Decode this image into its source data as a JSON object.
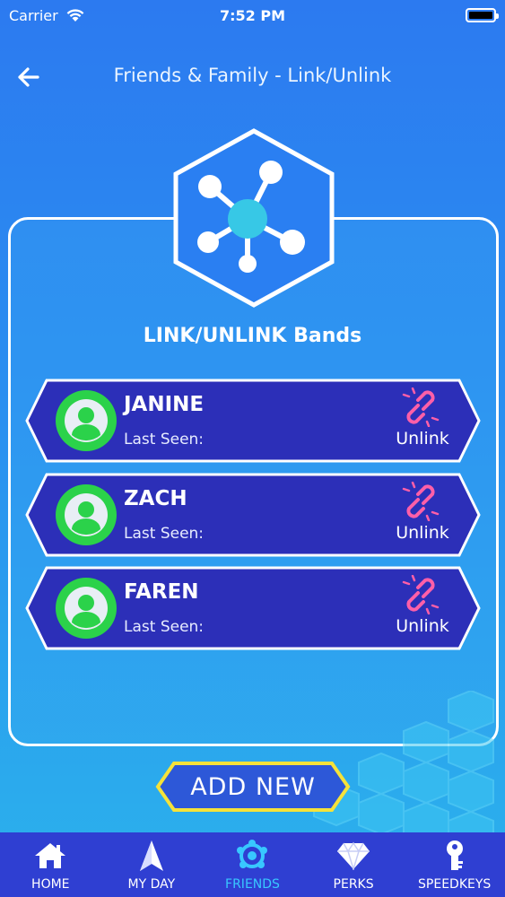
{
  "status_bar": {
    "carrier": "Carrier",
    "time": "7:52 PM"
  },
  "header": {
    "title": "Friends & Family - Link/Unlink"
  },
  "section": {
    "title": "LINK/UNLINK Bands"
  },
  "friends": [
    {
      "name": "JANINE",
      "last_seen_label": "Last Seen:",
      "action_label": "Unlink"
    },
    {
      "name": "ZACH",
      "last_seen_label": "Last Seen:",
      "action_label": "Unlink"
    },
    {
      "name": "FAREN",
      "last_seen_label": "Last Seen:",
      "action_label": "Unlink"
    }
  ],
  "add_new": {
    "label": "ADD NEW"
  },
  "tabs": [
    {
      "label": "HOME",
      "icon": "home-icon"
    },
    {
      "label": "MY DAY",
      "icon": "compass-arrow-icon"
    },
    {
      "label": "FRIENDS",
      "icon": "friends-network-icon",
      "active": true
    },
    {
      "label": "PERKS",
      "icon": "diamond-icon"
    },
    {
      "label": "SPEEDKEYS",
      "icon": "key-icon"
    }
  ],
  "colors": {
    "background_top": "#2c7af0",
    "background_bottom": "#2bb2ec",
    "card": "#2c2fb8",
    "avatar_green": "#2bd24a",
    "unlink_pink": "#ff5fa8",
    "add_new_border": "#f5e23a",
    "tabbar": "#2f3fd2",
    "active_tab": "#38c8ff"
  }
}
